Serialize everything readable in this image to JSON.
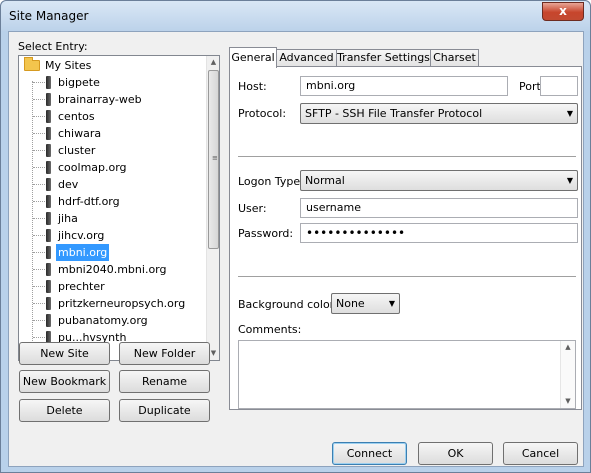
{
  "window": {
    "title": "Site Manager",
    "close_glyph": "x"
  },
  "left": {
    "select_entry_label": "Select Entry:",
    "root_label": "My Sites",
    "sites": [
      "bigpete",
      "brainarray-web",
      "centos",
      "chiwara",
      "cluster",
      "coolmap.org",
      "dev",
      "hdrf-dtf.org",
      "jiha",
      "jihcv.org",
      "mbni.org",
      "mbni2040.mbni.org",
      "prechter",
      "pritzkerneuropsych.org",
      "pubanatomy.org",
      "pu...hvsynth"
    ],
    "selected_site": "mbni.org",
    "buttons": {
      "new_site": "New Site",
      "new_folder": "New Folder",
      "new_bookmark": "New Bookmark",
      "rename": "Rename",
      "delete": "Delete",
      "duplicate": "Duplicate"
    }
  },
  "tabs": [
    "General",
    "Advanced",
    "Transfer Settings",
    "Charset"
  ],
  "active_tab": "General",
  "general": {
    "host_label": "Host:",
    "host_value": "mbni.org",
    "port_label": "Port:",
    "port_value": "",
    "protocol_label": "Protocol:",
    "protocol_value": "SFTP - SSH File Transfer Protocol",
    "logon_type_label": "Logon Type:",
    "logon_type_value": "Normal",
    "user_label": "User:",
    "user_value": "username",
    "password_label": "Password:",
    "password_value": "••••••••••••••",
    "bg_color_label": "Background color:",
    "bg_color_value": "None",
    "comments_label": "Comments:"
  },
  "bottom_buttons": {
    "connect": "Connect",
    "ok": "OK",
    "cancel": "Cancel"
  },
  "icons": {
    "folder": "folder-icon",
    "server": "server-icon",
    "dropdown": "chevron-down-icon"
  }
}
